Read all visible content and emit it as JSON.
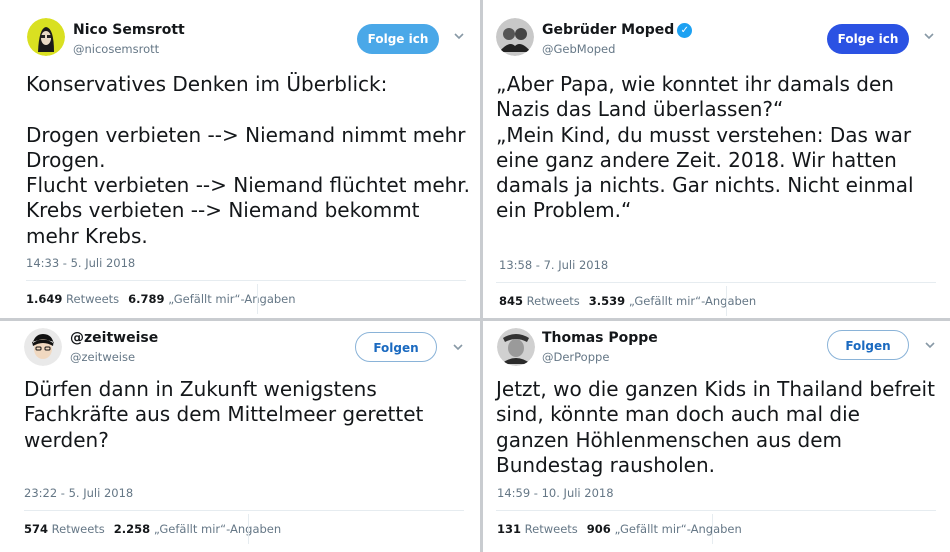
{
  "tweets": [
    {
      "name": "Nico Semsrott",
      "handle": "@nicosemsrott",
      "follow_label": "Folge ich",
      "text": "Konservatives Denken im Überblick:\n\nDrogen verbieten --> Niemand nimmt mehr Drogen.\nFlucht verbieten --> Niemand flüchtet mehr.\nKrebs verbieten --> Niemand bekommt mehr Krebs.",
      "time": "14:33 - 5. Juli 2018",
      "retweets_count": "1.649",
      "retweets_label": "Retweets",
      "likes_count": "6.789",
      "likes_label": "„Gefällt mir“-Angaben"
    },
    {
      "name": "Gebrüder Moped",
      "verified": true,
      "handle": "@GebMoped",
      "follow_label": "Folge ich",
      "text": "„Aber Papa, wie konntet ihr damals den Nazis das Land überlassen?“\n„Mein Kind, du musst verstehen: Das war eine ganz andere Zeit. 2018. Wir hatten damals ja nichts. Gar nichts. Nicht einmal ein Problem.“",
      "time": "13:58 - 7. Juli 2018",
      "retweets_count": "845",
      "retweets_label": "Retweets",
      "likes_count": "3.539",
      "likes_label": "„Gefällt mir“-Angaben"
    },
    {
      "name": "@zeitweise",
      "handle": "@zeitweise",
      "follow_label": "Folgen",
      "text": "Dürfen dann in Zukunft wenigstens Fachkräfte aus dem Mittelmeer gerettet werden?",
      "time": "23:22 - 5. Juli 2018",
      "retweets_count": "574",
      "retweets_label": "Retweets",
      "likes_count": "2.258",
      "likes_label": "„Gefällt mir“-Angaben"
    },
    {
      "name": "Thomas Poppe",
      "handle": "@DerPoppe",
      "follow_label": "Folgen",
      "text": "Jetzt, wo die ganzen Kids in Thailand befreit sind, könnte man doch auch mal die ganzen Höhlenmenschen aus dem Bundestag rausholen.",
      "time": "14:59 - 10. Juli 2018",
      "retweets_count": "131",
      "retweets_label": "Retweets",
      "likes_count": "906",
      "likes_label": "„Gefällt mir“-Angaben"
    }
  ],
  "colors": {
    "follow_filled": "#4aa8e8",
    "follow_filled_dark": "#2b52e3",
    "follow_outline_text": "#1b6ac0",
    "verified": "#1da1f2",
    "muted": "#657786"
  },
  "icons": {
    "verified": "verified-badge-icon",
    "menu": "chevron-down-icon"
  }
}
